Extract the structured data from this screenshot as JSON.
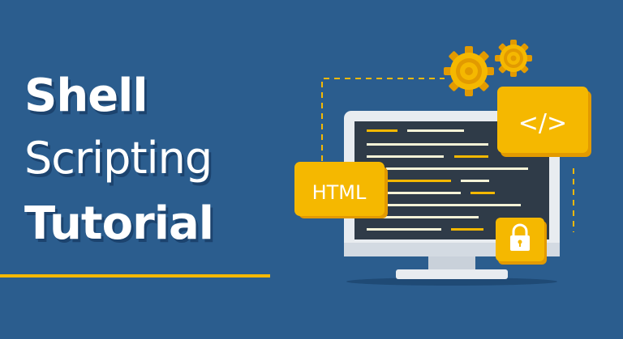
{
  "title": {
    "line1": "Shell",
    "line2": "Scripting",
    "line3": "Tutorial"
  },
  "badges": {
    "html_label": "HTML",
    "code_label": "</>"
  },
  "icons": [
    "gear-icon",
    "gear-icon",
    "code-icon",
    "lock-icon"
  ],
  "colors": {
    "background": "#2b5d8e",
    "accent": "#f5b800",
    "screen": "#2f3b48",
    "monitor_frame": "#e8ecf0",
    "text": "#ffffff"
  }
}
